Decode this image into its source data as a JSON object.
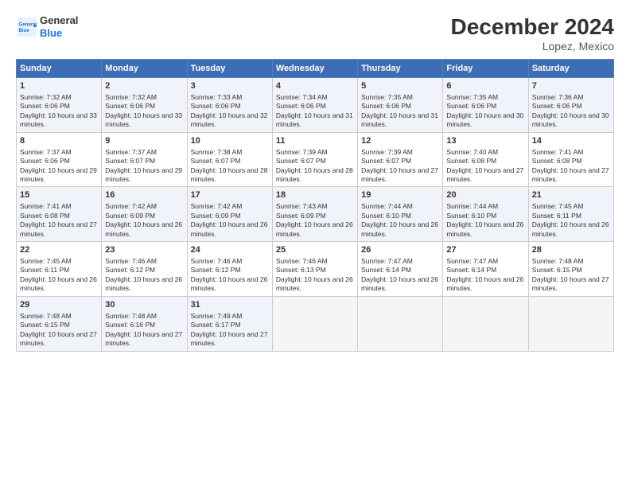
{
  "logo": {
    "line1": "General",
    "line2": "Blue"
  },
  "title": "December 2024",
  "location": "Lopez, Mexico",
  "days_of_week": [
    "Sunday",
    "Monday",
    "Tuesday",
    "Wednesday",
    "Thursday",
    "Friday",
    "Saturday"
  ],
  "weeks": [
    [
      {
        "day": 1,
        "sunrise": "7:32 AM",
        "sunset": "6:06 PM",
        "daylight": "10 hours and 33 minutes."
      },
      {
        "day": 2,
        "sunrise": "7:32 AM",
        "sunset": "6:06 PM",
        "daylight": "10 hours and 33 minutes."
      },
      {
        "day": 3,
        "sunrise": "7:33 AM",
        "sunset": "6:06 PM",
        "daylight": "10 hours and 32 minutes."
      },
      {
        "day": 4,
        "sunrise": "7:34 AM",
        "sunset": "6:06 PM",
        "daylight": "10 hours and 31 minutes."
      },
      {
        "day": 5,
        "sunrise": "7:35 AM",
        "sunset": "6:06 PM",
        "daylight": "10 hours and 31 minutes."
      },
      {
        "day": 6,
        "sunrise": "7:35 AM",
        "sunset": "6:06 PM",
        "daylight": "10 hours and 30 minutes."
      },
      {
        "day": 7,
        "sunrise": "7:36 AM",
        "sunset": "6:06 PM",
        "daylight": "10 hours and 30 minutes."
      }
    ],
    [
      {
        "day": 8,
        "sunrise": "7:37 AM",
        "sunset": "6:06 PM",
        "daylight": "10 hours and 29 minutes."
      },
      {
        "day": 9,
        "sunrise": "7:37 AM",
        "sunset": "6:07 PM",
        "daylight": "10 hours and 29 minutes."
      },
      {
        "day": 10,
        "sunrise": "7:38 AM",
        "sunset": "6:07 PM",
        "daylight": "10 hours and 28 minutes."
      },
      {
        "day": 11,
        "sunrise": "7:39 AM",
        "sunset": "6:07 PM",
        "daylight": "10 hours and 28 minutes."
      },
      {
        "day": 12,
        "sunrise": "7:39 AM",
        "sunset": "6:07 PM",
        "daylight": "10 hours and 27 minutes."
      },
      {
        "day": 13,
        "sunrise": "7:40 AM",
        "sunset": "6:08 PM",
        "daylight": "10 hours and 27 minutes."
      },
      {
        "day": 14,
        "sunrise": "7:41 AM",
        "sunset": "6:08 PM",
        "daylight": "10 hours and 27 minutes."
      }
    ],
    [
      {
        "day": 15,
        "sunrise": "7:41 AM",
        "sunset": "6:08 PM",
        "daylight": "10 hours and 27 minutes."
      },
      {
        "day": 16,
        "sunrise": "7:42 AM",
        "sunset": "6:09 PM",
        "daylight": "10 hours and 26 minutes."
      },
      {
        "day": 17,
        "sunrise": "7:42 AM",
        "sunset": "6:09 PM",
        "daylight": "10 hours and 26 minutes."
      },
      {
        "day": 18,
        "sunrise": "7:43 AM",
        "sunset": "6:09 PM",
        "daylight": "10 hours and 26 minutes."
      },
      {
        "day": 19,
        "sunrise": "7:44 AM",
        "sunset": "6:10 PM",
        "daylight": "10 hours and 26 minutes."
      },
      {
        "day": 20,
        "sunrise": "7:44 AM",
        "sunset": "6:10 PM",
        "daylight": "10 hours and 26 minutes."
      },
      {
        "day": 21,
        "sunrise": "7:45 AM",
        "sunset": "6:11 PM",
        "daylight": "10 hours and 26 minutes."
      }
    ],
    [
      {
        "day": 22,
        "sunrise": "7:45 AM",
        "sunset": "6:11 PM",
        "daylight": "10 hours and 26 minutes."
      },
      {
        "day": 23,
        "sunrise": "7:46 AM",
        "sunset": "6:12 PM",
        "daylight": "10 hours and 26 minutes."
      },
      {
        "day": 24,
        "sunrise": "7:46 AM",
        "sunset": "6:12 PM",
        "daylight": "10 hours and 26 minutes."
      },
      {
        "day": 25,
        "sunrise": "7:46 AM",
        "sunset": "6:13 PM",
        "daylight": "10 hours and 26 minutes."
      },
      {
        "day": 26,
        "sunrise": "7:47 AM",
        "sunset": "6:14 PM",
        "daylight": "10 hours and 26 minutes."
      },
      {
        "day": 27,
        "sunrise": "7:47 AM",
        "sunset": "6:14 PM",
        "daylight": "10 hours and 26 minutes."
      },
      {
        "day": 28,
        "sunrise": "7:48 AM",
        "sunset": "6:15 PM",
        "daylight": "10 hours and 27 minutes."
      }
    ],
    [
      {
        "day": 29,
        "sunrise": "7:48 AM",
        "sunset": "6:15 PM",
        "daylight": "10 hours and 27 minutes."
      },
      {
        "day": 30,
        "sunrise": "7:48 AM",
        "sunset": "6:16 PM",
        "daylight": "10 hours and 27 minutes."
      },
      {
        "day": 31,
        "sunrise": "7:49 AM",
        "sunset": "6:17 PM",
        "daylight": "10 hours and 27 minutes."
      },
      null,
      null,
      null,
      null
    ]
  ]
}
